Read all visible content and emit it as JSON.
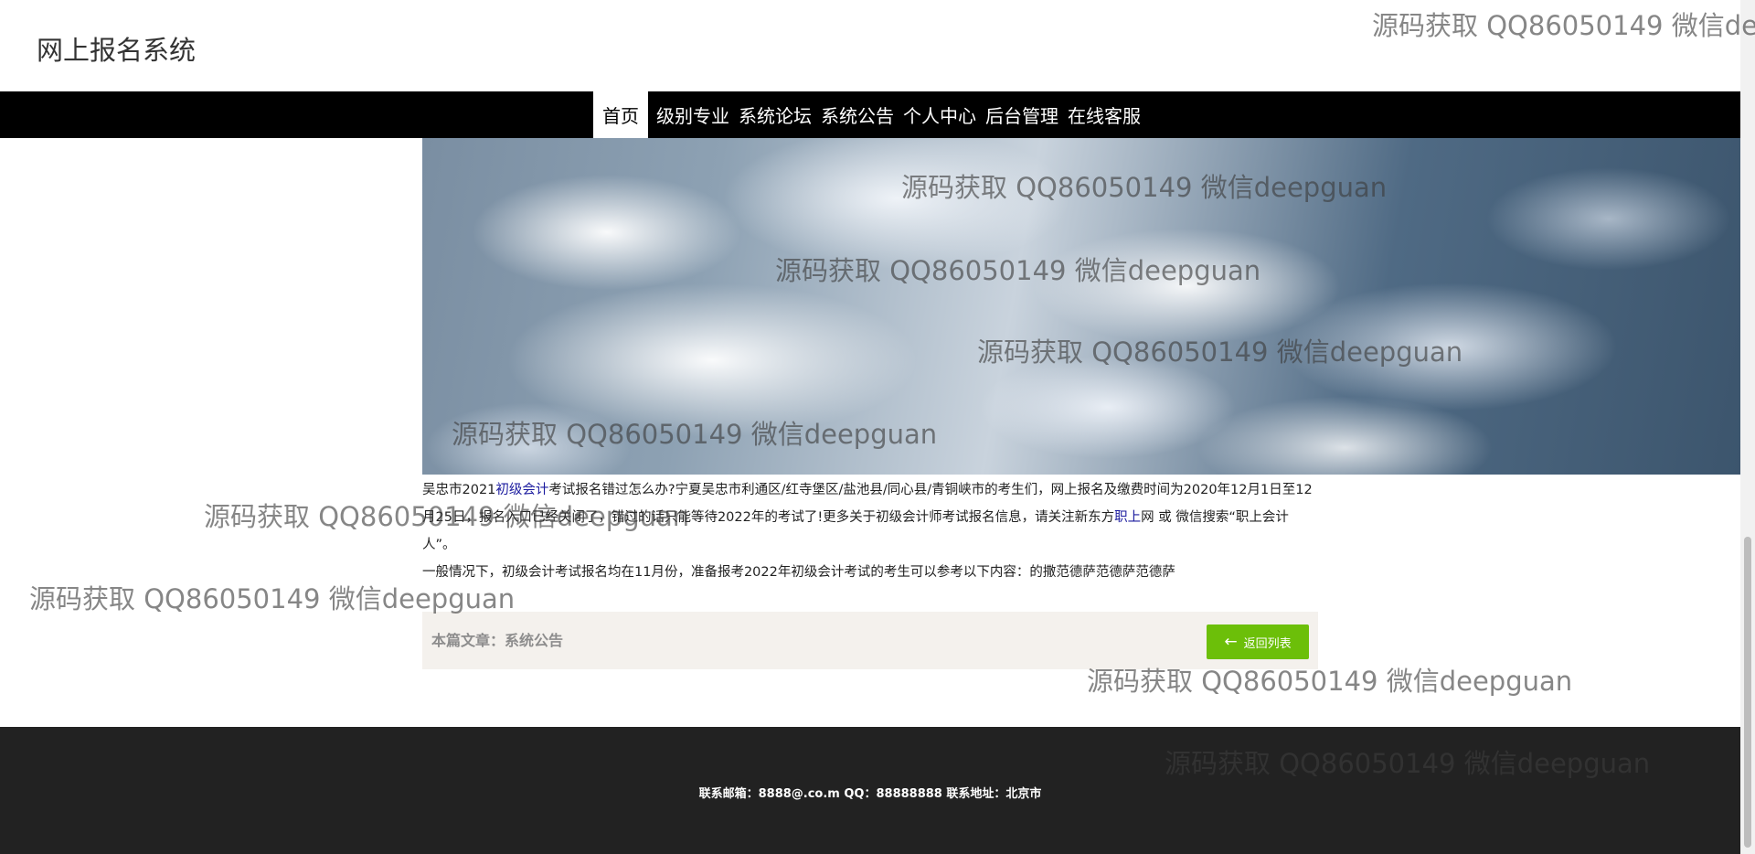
{
  "site": {
    "title": "网上报名系统"
  },
  "nav": {
    "items": [
      {
        "label": "首页",
        "active": true
      },
      {
        "label": "级别专业",
        "active": false
      },
      {
        "label": "系统论坛",
        "active": false
      },
      {
        "label": "系统公告",
        "active": false
      },
      {
        "label": "个人中心",
        "active": false
      },
      {
        "label": "后台管理",
        "active": false
      },
      {
        "label": "在线客服",
        "active": false
      }
    ]
  },
  "article": {
    "p1_a": "吴忠市2021",
    "p1_link1": "初级会计",
    "p1_b": "考试报名错过怎么办?宁夏吴忠市利通区/红寺堡区/盐池县/同心县/青铜峡市的考生们，网上报名及缴费时间为2020年12月1日至12月25日，报名入口已经关闭了，错过的话只能等待2022年的考试了!更多关于初级会计师考试报名信息，请关注新东方",
    "p1_link2": "职上",
    "p1_c": "网 或 微信搜索“职上会计人”。",
    "p2": "一般情况下，初级会计考试报名均在11月份，准备报考2022年初级会计考试的考生可以参考以下内容：的撒范德萨范德萨范德萨"
  },
  "article_bar": {
    "label": "本篇文章：系统公告",
    "back_label": "返回列表",
    "back_icon": "arrow-left-icon"
  },
  "footer": {
    "text": "联系邮箱：8888@.co.m QQ：88888888 联系地址：北京市"
  },
  "watermark": {
    "text": "源码获取 QQ86050149 微信deepguan",
    "text_cut_right": "源码获取 QQ86050149 微信de"
  },
  "colors": {
    "navbar_bg": "#000000",
    "button_green": "#6cbf09",
    "footer_bg": "#222222",
    "link_blue": "#1a1a9e",
    "bar_bg": "#f4f1ed"
  }
}
